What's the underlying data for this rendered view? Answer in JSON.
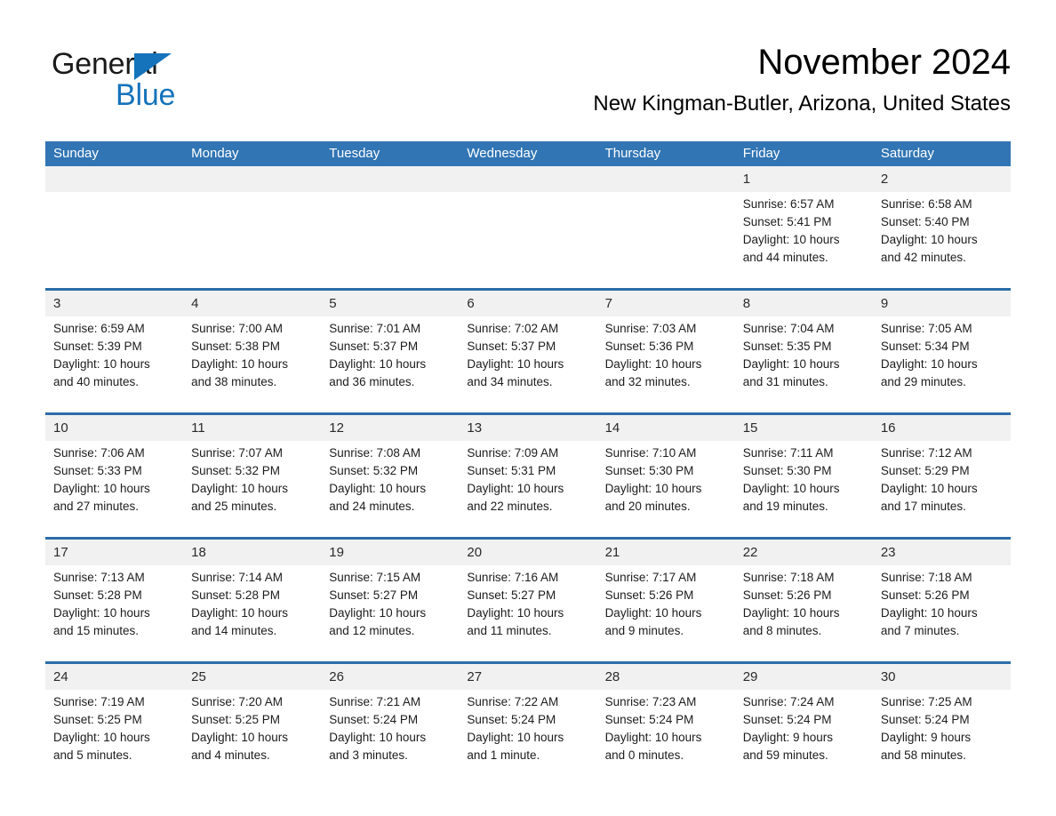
{
  "logo": {
    "word1": "General",
    "word2": "Blue",
    "triangle_color": "#1473bb"
  },
  "header": {
    "title": "November 2024",
    "subtitle": "New Kingman-Butler, Arizona, United States"
  },
  "colors": {
    "header_blue": "#3175b4",
    "row_divider_blue": "#2b6ca8",
    "date_band_gray": "#f1f1f1",
    "background": "#ffffff"
  },
  "weekdays": [
    "Sunday",
    "Monday",
    "Tuesday",
    "Wednesday",
    "Thursday",
    "Friday",
    "Saturday"
  ],
  "weeks": [
    {
      "dates": [
        "",
        "",
        "",
        "",
        "",
        "1",
        "2"
      ],
      "cells": [
        {
          "sunrise": "",
          "sunset": "",
          "daylight1": "",
          "daylight2": ""
        },
        {
          "sunrise": "",
          "sunset": "",
          "daylight1": "",
          "daylight2": ""
        },
        {
          "sunrise": "",
          "sunset": "",
          "daylight1": "",
          "daylight2": ""
        },
        {
          "sunrise": "",
          "sunset": "",
          "daylight1": "",
          "daylight2": ""
        },
        {
          "sunrise": "",
          "sunset": "",
          "daylight1": "",
          "daylight2": ""
        },
        {
          "sunrise": "Sunrise: 6:57 AM",
          "sunset": "Sunset: 5:41 PM",
          "daylight1": "Daylight: 10 hours",
          "daylight2": "and 44 minutes."
        },
        {
          "sunrise": "Sunrise: 6:58 AM",
          "sunset": "Sunset: 5:40 PM",
          "daylight1": "Daylight: 10 hours",
          "daylight2": "and 42 minutes."
        }
      ]
    },
    {
      "dates": [
        "3",
        "4",
        "5",
        "6",
        "7",
        "8",
        "9"
      ],
      "cells": [
        {
          "sunrise": "Sunrise: 6:59 AM",
          "sunset": "Sunset: 5:39 PM",
          "daylight1": "Daylight: 10 hours",
          "daylight2": "and 40 minutes."
        },
        {
          "sunrise": "Sunrise: 7:00 AM",
          "sunset": "Sunset: 5:38 PM",
          "daylight1": "Daylight: 10 hours",
          "daylight2": "and 38 minutes."
        },
        {
          "sunrise": "Sunrise: 7:01 AM",
          "sunset": "Sunset: 5:37 PM",
          "daylight1": "Daylight: 10 hours",
          "daylight2": "and 36 minutes."
        },
        {
          "sunrise": "Sunrise: 7:02 AM",
          "sunset": "Sunset: 5:37 PM",
          "daylight1": "Daylight: 10 hours",
          "daylight2": "and 34 minutes."
        },
        {
          "sunrise": "Sunrise: 7:03 AM",
          "sunset": "Sunset: 5:36 PM",
          "daylight1": "Daylight: 10 hours",
          "daylight2": "and 32 minutes."
        },
        {
          "sunrise": "Sunrise: 7:04 AM",
          "sunset": "Sunset: 5:35 PM",
          "daylight1": "Daylight: 10 hours",
          "daylight2": "and 31 minutes."
        },
        {
          "sunrise": "Sunrise: 7:05 AM",
          "sunset": "Sunset: 5:34 PM",
          "daylight1": "Daylight: 10 hours",
          "daylight2": "and 29 minutes."
        }
      ]
    },
    {
      "dates": [
        "10",
        "11",
        "12",
        "13",
        "14",
        "15",
        "16"
      ],
      "cells": [
        {
          "sunrise": "Sunrise: 7:06 AM",
          "sunset": "Sunset: 5:33 PM",
          "daylight1": "Daylight: 10 hours",
          "daylight2": "and 27 minutes."
        },
        {
          "sunrise": "Sunrise: 7:07 AM",
          "sunset": "Sunset: 5:32 PM",
          "daylight1": "Daylight: 10 hours",
          "daylight2": "and 25 minutes."
        },
        {
          "sunrise": "Sunrise: 7:08 AM",
          "sunset": "Sunset: 5:32 PM",
          "daylight1": "Daylight: 10 hours",
          "daylight2": "and 24 minutes."
        },
        {
          "sunrise": "Sunrise: 7:09 AM",
          "sunset": "Sunset: 5:31 PM",
          "daylight1": "Daylight: 10 hours",
          "daylight2": "and 22 minutes."
        },
        {
          "sunrise": "Sunrise: 7:10 AM",
          "sunset": "Sunset: 5:30 PM",
          "daylight1": "Daylight: 10 hours",
          "daylight2": "and 20 minutes."
        },
        {
          "sunrise": "Sunrise: 7:11 AM",
          "sunset": "Sunset: 5:30 PM",
          "daylight1": "Daylight: 10 hours",
          "daylight2": "and 19 minutes."
        },
        {
          "sunrise": "Sunrise: 7:12 AM",
          "sunset": "Sunset: 5:29 PM",
          "daylight1": "Daylight: 10 hours",
          "daylight2": "and 17 minutes."
        }
      ]
    },
    {
      "dates": [
        "17",
        "18",
        "19",
        "20",
        "21",
        "22",
        "23"
      ],
      "cells": [
        {
          "sunrise": "Sunrise: 7:13 AM",
          "sunset": "Sunset: 5:28 PM",
          "daylight1": "Daylight: 10 hours",
          "daylight2": "and 15 minutes."
        },
        {
          "sunrise": "Sunrise: 7:14 AM",
          "sunset": "Sunset: 5:28 PM",
          "daylight1": "Daylight: 10 hours",
          "daylight2": "and 14 minutes."
        },
        {
          "sunrise": "Sunrise: 7:15 AM",
          "sunset": "Sunset: 5:27 PM",
          "daylight1": "Daylight: 10 hours",
          "daylight2": "and 12 minutes."
        },
        {
          "sunrise": "Sunrise: 7:16 AM",
          "sunset": "Sunset: 5:27 PM",
          "daylight1": "Daylight: 10 hours",
          "daylight2": "and 11 minutes."
        },
        {
          "sunrise": "Sunrise: 7:17 AM",
          "sunset": "Sunset: 5:26 PM",
          "daylight1": "Daylight: 10 hours",
          "daylight2": "and 9 minutes."
        },
        {
          "sunrise": "Sunrise: 7:18 AM",
          "sunset": "Sunset: 5:26 PM",
          "daylight1": "Daylight: 10 hours",
          "daylight2": "and 8 minutes."
        },
        {
          "sunrise": "Sunrise: 7:18 AM",
          "sunset": "Sunset: 5:26 PM",
          "daylight1": "Daylight: 10 hours",
          "daylight2": "and 7 minutes."
        }
      ]
    },
    {
      "dates": [
        "24",
        "25",
        "26",
        "27",
        "28",
        "29",
        "30"
      ],
      "cells": [
        {
          "sunrise": "Sunrise: 7:19 AM",
          "sunset": "Sunset: 5:25 PM",
          "daylight1": "Daylight: 10 hours",
          "daylight2": "and 5 minutes."
        },
        {
          "sunrise": "Sunrise: 7:20 AM",
          "sunset": "Sunset: 5:25 PM",
          "daylight1": "Daylight: 10 hours",
          "daylight2": "and 4 minutes."
        },
        {
          "sunrise": "Sunrise: 7:21 AM",
          "sunset": "Sunset: 5:24 PM",
          "daylight1": "Daylight: 10 hours",
          "daylight2": "and 3 minutes."
        },
        {
          "sunrise": "Sunrise: 7:22 AM",
          "sunset": "Sunset: 5:24 PM",
          "daylight1": "Daylight: 10 hours",
          "daylight2": "and 1 minute."
        },
        {
          "sunrise": "Sunrise: 7:23 AM",
          "sunset": "Sunset: 5:24 PM",
          "daylight1": "Daylight: 10 hours",
          "daylight2": "and 0 minutes."
        },
        {
          "sunrise": "Sunrise: 7:24 AM",
          "sunset": "Sunset: 5:24 PM",
          "daylight1": "Daylight: 9 hours",
          "daylight2": "and 59 minutes."
        },
        {
          "sunrise": "Sunrise: 7:25 AM",
          "sunset": "Sunset: 5:24 PM",
          "daylight1": "Daylight: 9 hours",
          "daylight2": "and 58 minutes."
        }
      ]
    }
  ]
}
